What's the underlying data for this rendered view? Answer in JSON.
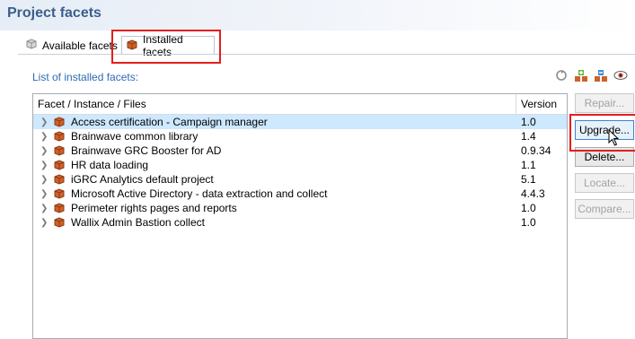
{
  "page": {
    "title": "Project facets"
  },
  "tabs": [
    {
      "label": "Available facets",
      "selected": false
    },
    {
      "label": "Installed facets",
      "selected": true
    }
  ],
  "list": {
    "label": "List of installed facets:"
  },
  "toolbar": {
    "icons": [
      "refresh-icon",
      "add-facet-icon",
      "remove-facet-icon",
      "view-icon"
    ]
  },
  "table": {
    "columns": [
      "Facet / Instance / Files",
      "Version"
    ],
    "rows": [
      {
        "name": "Access certification - Campaign manager",
        "version": "1.0",
        "selected": true
      },
      {
        "name": "Brainwave common library",
        "version": "1.4"
      },
      {
        "name": "Brainwave GRC Booster for AD",
        "version": "0.9.34"
      },
      {
        "name": "HR data loading",
        "version": "1.1"
      },
      {
        "name": "iGRC Analytics default project",
        "version": "5.1"
      },
      {
        "name": "Microsoft Active Directory - data extraction and collect",
        "version": "4.4.3"
      },
      {
        "name": "Perimeter rights pages and reports",
        "version": "1.0"
      },
      {
        "name": "Wallix Admin Bastion collect",
        "version": "1.0"
      }
    ]
  },
  "buttons": {
    "repair": "Repair...",
    "upgrade": "Upgrade...",
    "delete": "Delete...",
    "locate": "Locate...",
    "compare": "Compare..."
  },
  "colors": {
    "highlight": "#e51d1d",
    "accent": "#3b5f8c",
    "link": "#2e6bb5",
    "selection": "#cde8ff"
  }
}
